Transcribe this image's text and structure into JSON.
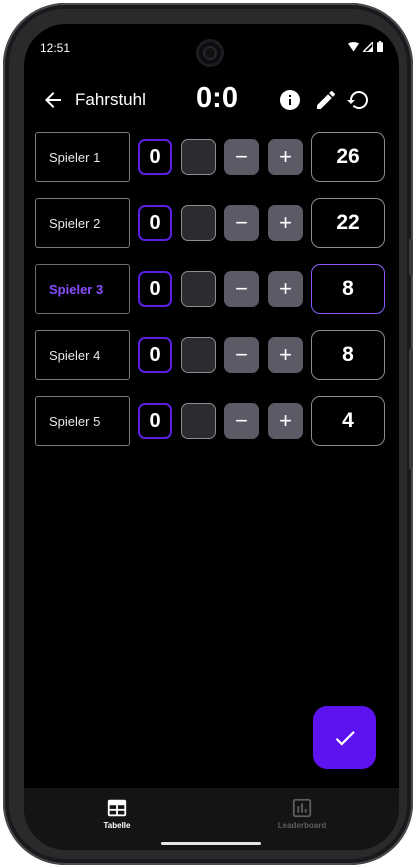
{
  "status_bar": {
    "time": "12:51"
  },
  "app_bar": {
    "title": "Fahrstuhl",
    "score": "0:0"
  },
  "players": [
    {
      "name": "Spieler 1",
      "round": "0",
      "total": "26",
      "active": false
    },
    {
      "name": "Spieler 2",
      "round": "0",
      "total": "22",
      "active": false
    },
    {
      "name": "Spieler 3",
      "round": "0",
      "total": "8",
      "active": true
    },
    {
      "name": "Spieler 4",
      "round": "0",
      "total": "8",
      "active": false
    },
    {
      "name": "Spieler 5",
      "round": "0",
      "total": "4",
      "active": false
    }
  ],
  "controls": {
    "minus_label": "−",
    "plus_label": "+"
  },
  "bottom_nav": {
    "items": [
      {
        "label": "Tabelle",
        "icon": "table-icon",
        "active": true
      },
      {
        "label": "Leaderboard",
        "icon": "leaderboard-icon",
        "active": false
      }
    ]
  },
  "colors": {
    "accent": "#5d12f0",
    "active_name": "#8a4dff",
    "step_button": "#5d5a67",
    "background": "#000000"
  },
  "icons": {
    "back": "arrow-left-icon",
    "info": "info-icon",
    "edit": "pencil-icon",
    "reset": "refresh-icon",
    "confirm": "check-icon"
  }
}
